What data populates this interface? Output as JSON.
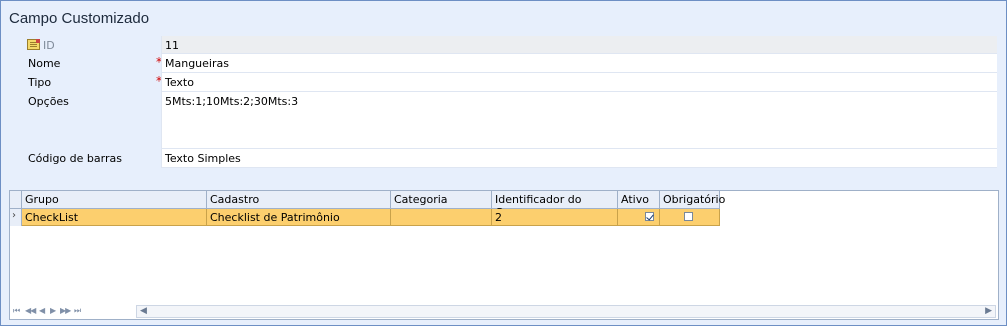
{
  "window": {
    "title": "Campo Customizado"
  },
  "form": {
    "id": {
      "label": "ID",
      "value": "11"
    },
    "nome": {
      "label": "Nome",
      "value": "Mangueiras",
      "required_mark": "*"
    },
    "tipo": {
      "label": "Tipo",
      "value": "Texto",
      "required_mark": "*"
    },
    "opcoes": {
      "label": "Opções",
      "value": "5Mts:1;10Mts:2;30Mts:3"
    },
    "codigo_barras": {
      "label": "Código de barras",
      "value": "Texto Simples"
    }
  },
  "grid": {
    "columns": [
      "Grupo",
      "Cadastro",
      "Categoria",
      "Identificador do Campo",
      "Ativo",
      "Obrigatório"
    ],
    "rows": [
      {
        "indicator": "›",
        "grupo": "CheckList",
        "cadastro": "Checklist de Patrimônio",
        "categoria": "",
        "identificador": "2",
        "ativo": true,
        "obrigatorio": false
      }
    ],
    "navigator": {
      "first": "⏮",
      "prev_page": "◀◀",
      "prev": "◀",
      "next": "▶",
      "next_page": "▶▶",
      "last": "⏭"
    },
    "scroll_left": "◀",
    "scroll_right": "▶"
  },
  "colors": {
    "selected_row": "#fccf6e",
    "background": "#e7effc",
    "required": "#d00000"
  }
}
